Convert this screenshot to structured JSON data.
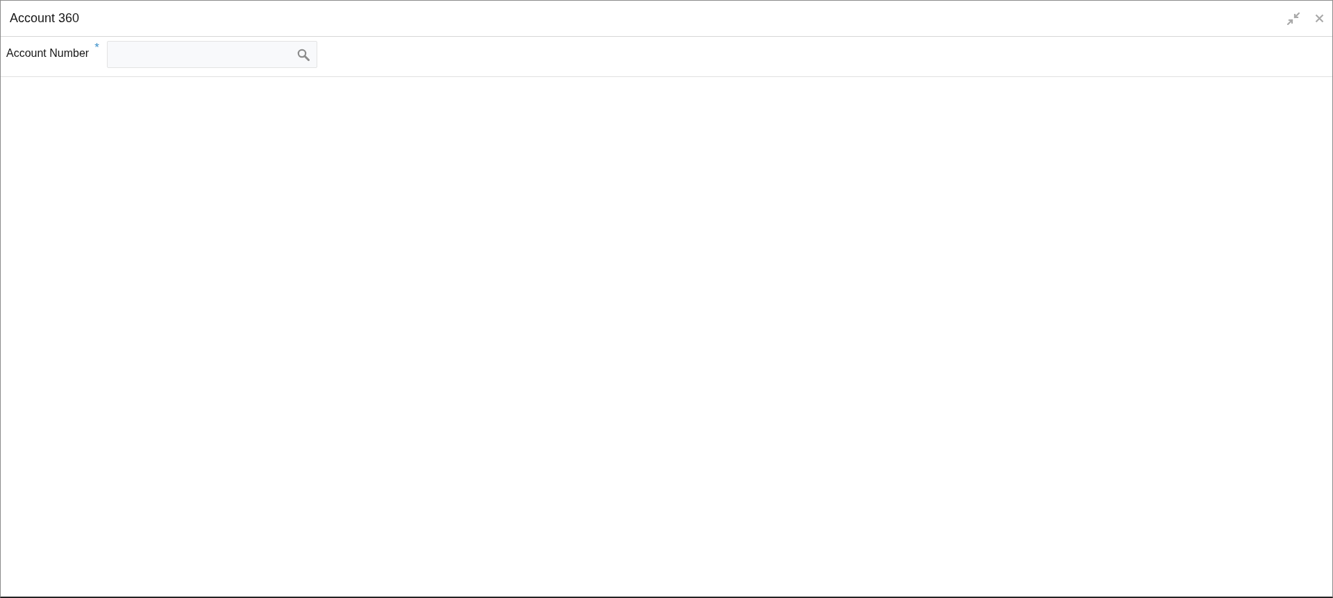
{
  "window": {
    "title": "Account 360"
  },
  "form": {
    "fields": [
      {
        "label": "Account Number",
        "required_mark": "*",
        "kind": "search"
      }
    ]
  }
}
